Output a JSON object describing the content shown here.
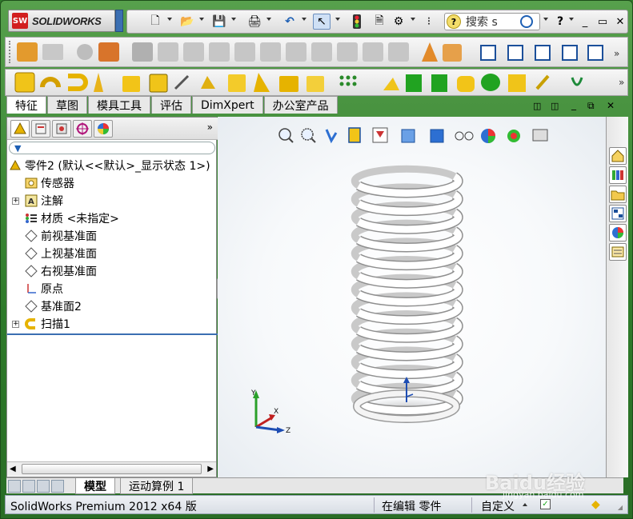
{
  "app": {
    "logo_text": "SOLIDWORKS",
    "logo_badge": "SW"
  },
  "toolbar": {
    "search_placeholder": "搜索 s",
    "help_label": "?"
  },
  "command_tabs": [
    {
      "label": "特征",
      "active": true
    },
    {
      "label": "草图",
      "active": false
    },
    {
      "label": "模具工具",
      "active": false
    },
    {
      "label": "评估",
      "active": false
    },
    {
      "label": "DimXpert",
      "active": false
    },
    {
      "label": "办公室产品",
      "active": false
    }
  ],
  "feature_tree": {
    "root": "零件2  (默认<<默认>_显示状态 1>)",
    "items": [
      {
        "label": "传感器",
        "icon": "sensor-icon",
        "expandable": false
      },
      {
        "label": "注解",
        "icon": "annotation-icon",
        "expandable": true
      },
      {
        "label": "材质 <未指定>",
        "icon": "material-icon",
        "expandable": false
      },
      {
        "label": "前视基准面",
        "icon": "plane-icon",
        "expandable": false
      },
      {
        "label": "上视基准面",
        "icon": "plane-icon",
        "expandable": false
      },
      {
        "label": "右视基准面",
        "icon": "plane-icon",
        "expandable": false
      },
      {
        "label": "原点",
        "icon": "origin-icon",
        "expandable": false
      },
      {
        "label": "基准面2",
        "icon": "plane-icon",
        "expandable": false
      },
      {
        "label": "扫描1",
        "icon": "sweep-icon",
        "expandable": true
      }
    ]
  },
  "model_tabs": [
    {
      "label": "模型",
      "active": true
    },
    {
      "label": "运动算例 1",
      "active": false
    }
  ],
  "status_bar": {
    "product": "SolidWorks Premium 2012 x64 版",
    "mode": "在编辑 零件",
    "units": "自定义"
  },
  "triad": {
    "x": "X",
    "y": "Y",
    "z": "Z"
  },
  "watermark": {
    "brand": "Baidu经验",
    "url": "jingyan.baidu.com"
  },
  "colors": {
    "frame_green": "#2e7a2a",
    "accent_blue": "#3b6fb2",
    "spring_white": "#ffffff"
  }
}
